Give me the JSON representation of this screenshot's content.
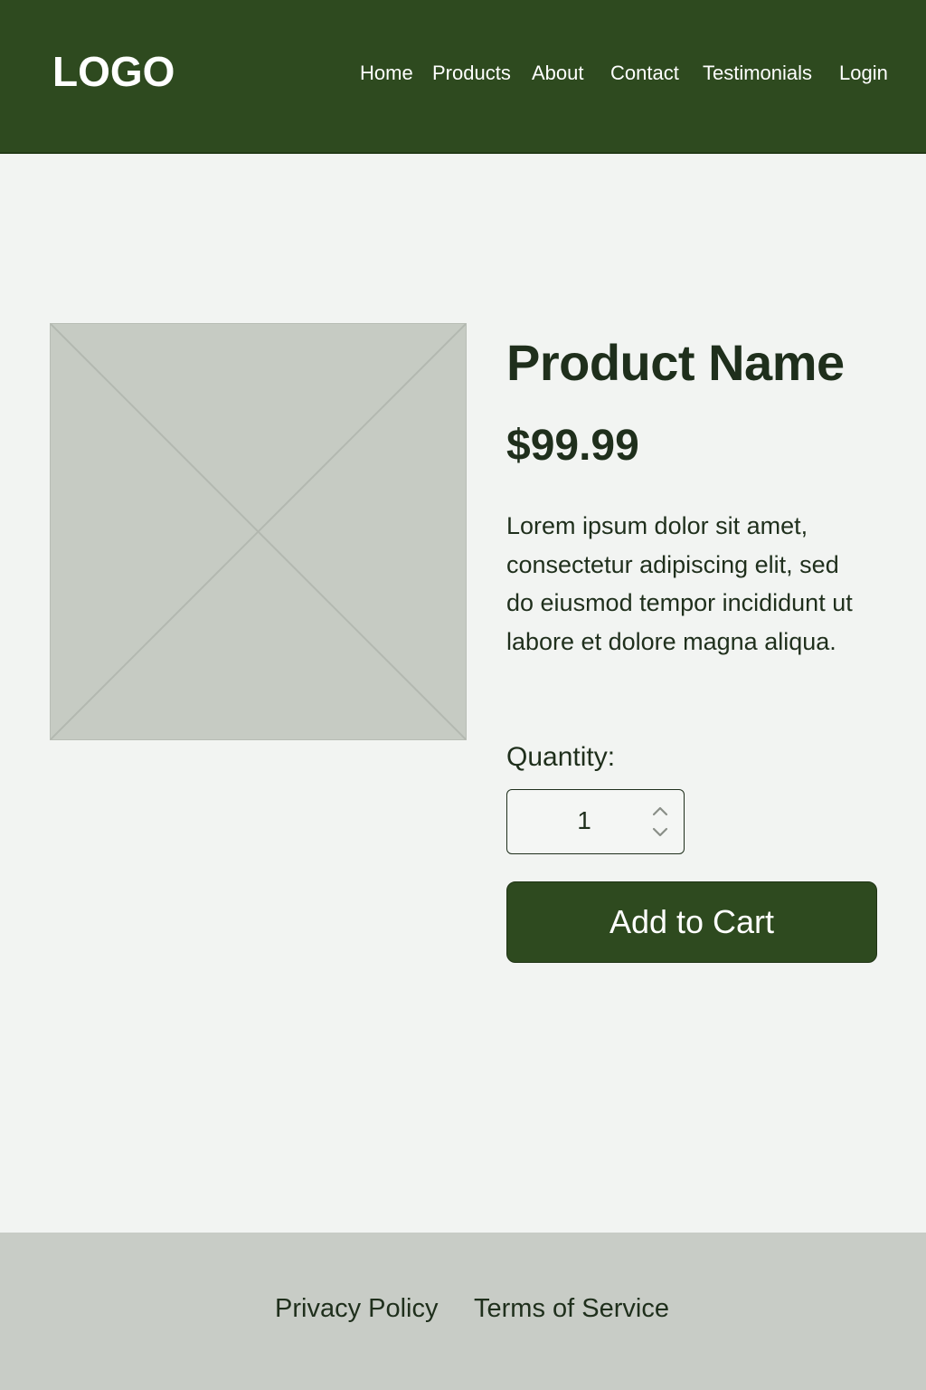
{
  "header": {
    "logo": "LOGO",
    "nav": [
      {
        "label": "Home"
      },
      {
        "label": "Products"
      },
      {
        "label": "About"
      },
      {
        "label": "Contact"
      },
      {
        "label": "Testimonials"
      },
      {
        "label": "Login"
      }
    ]
  },
  "product": {
    "image_placeholder": "image-placeholder-icon",
    "name": "Product Name",
    "price": "$99.99",
    "description": "Lorem ipsum dolor sit amet, consectetur adipiscing elit, sed do eiusmod tempor incididunt ut labore et dolore magna aliqua.",
    "quantity_label": "Quantity:",
    "quantity_value": "1",
    "add_to_cart_label": "Add to Cart"
  },
  "footer": {
    "links": [
      {
        "label": "Privacy Policy"
      },
      {
        "label": "Terms of Service"
      }
    ]
  },
  "colors": {
    "brand_green": "#2e4a1f",
    "background": "#f2f4f2",
    "footer_gray": "#c8ccc6",
    "text_dark": "#1f2f1c"
  }
}
